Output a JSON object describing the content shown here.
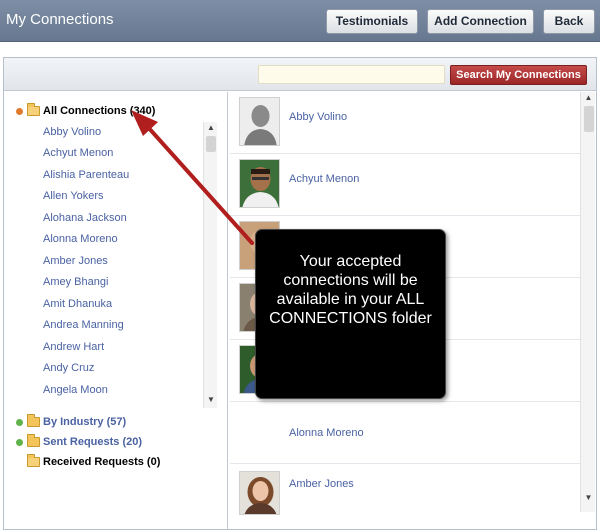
{
  "header": {
    "title": "My Connections",
    "buttons": {
      "testimonials": "Testimonials",
      "add_connection": "Add Connection",
      "back": "Back"
    }
  },
  "search": {
    "placeholder": "",
    "button_label": "Search My Connections"
  },
  "tree": {
    "all_connections": "All Connections (340)",
    "connections": [
      "Abby Volino",
      "Achyut Menon",
      "Alishia Parenteau",
      "Allen Yokers",
      "Alohana Jackson",
      "Alonna Moreno",
      "Amber Jones",
      "Amey Bhangi",
      "Amit Dhanuka",
      "Andrea Manning",
      "Andrew Hart",
      "Andy Cruz",
      "Angela Moon"
    ],
    "by_industry": "By Industry (57)",
    "sent_requests": "Sent Requests (20)",
    "received_requests": "Received Requests (0)"
  },
  "list": {
    "rows": [
      "Abby Volino",
      "Achyut Menon",
      "",
      "",
      "",
      "Alonna Moreno",
      "Amber Jones"
    ]
  },
  "callout": {
    "text": "Your accepted connections will be available in your ALL CONNECTIONS folder"
  },
  "colors": {
    "header": "#6f7f97",
    "search_button": "#b23434",
    "link": "#4a62a3",
    "arrow": "#b01e1e"
  }
}
